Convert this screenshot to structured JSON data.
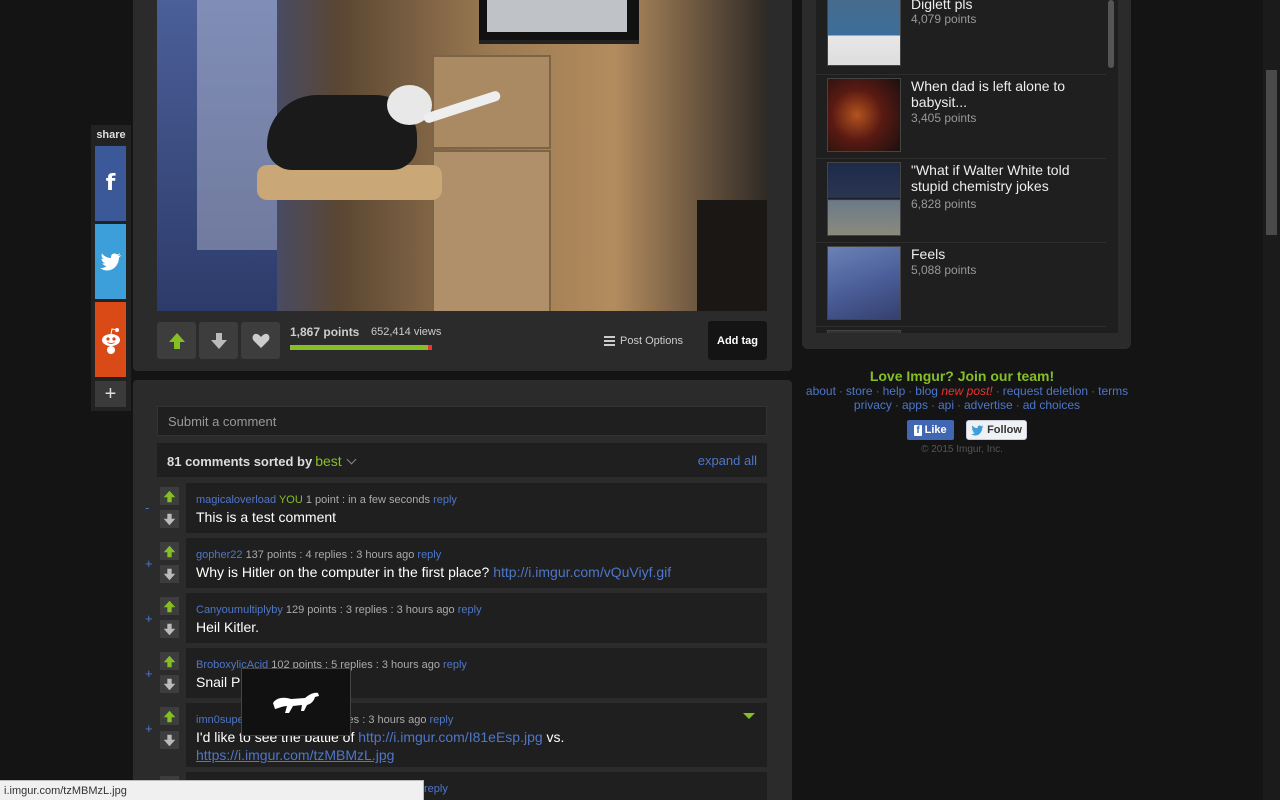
{
  "post": {
    "points": "1,867 points",
    "views": "652,414 views",
    "post_options": "Post Options",
    "add_tag": "Add tag",
    "upvote_ratio": 0.97
  },
  "share": {
    "label": "share",
    "more": "+"
  },
  "comments": {
    "placeholder": "Submit a comment",
    "count_label": "81 comments sorted by",
    "sort_value": "best",
    "expand_all": "expand all",
    "items": [
      {
        "user": "magicaloverload",
        "you": "YOU",
        "meta": "1 point : in a few seconds",
        "reply": "reply",
        "text": "This is a test comment",
        "toggle": "-"
      },
      {
        "user": "gopher22",
        "meta": "137 points : 4 replies : 3 hours ago",
        "reply": "reply",
        "text": "Why is Hitler on the computer in the first place?",
        "link": "http://i.imgur.com/vQuViyf.gif",
        "toggle": "+"
      },
      {
        "user": "Canyoumultiplyby",
        "meta": "129 points : 3 replies : 3 hours ago",
        "reply": "reply",
        "text": "Heil Kitler.",
        "toggle": "+"
      },
      {
        "user": "BroboxylicAcid",
        "meta": "102 points : 5 replies : 3 hours ago",
        "reply": "reply",
        "text": "Snail P",
        "toggle": "+"
      },
      {
        "user": "imn0supe",
        "meta": "replies : 3 hours ago",
        "reply": "reply",
        "text": "I'd like to see the battle of",
        "link": "http://i.imgur.com/I81eEsp.jpg",
        "text_after": "vs.",
        "link2": "https://i.imgur.com/tzMBMzL.jpg",
        "toggle": "+"
      },
      {
        "reply": "reply"
      }
    ]
  },
  "status_bar": {
    "url": "i.imgur.com/tzMBMzL.jpg"
  },
  "sidebar": {
    "items": [
      {
        "title": "Diglett pls",
        "points": "4,079 points"
      },
      {
        "title": "When dad is left alone to babysit...",
        "points": "3,405 points"
      },
      {
        "title": "\"What if Walter White told stupid chemistry jokes",
        "points": "6,828 points"
      },
      {
        "title": "Feels",
        "points": "5,088 points"
      }
    ]
  },
  "footer": {
    "love": "Love Imgur? Join our team!",
    "links1": [
      "about",
      "store",
      "help",
      "blog"
    ],
    "new_post": "new post!",
    "links1b": [
      "request deletion",
      "terms"
    ],
    "links2": [
      "privacy",
      "apps",
      "api",
      "advertise",
      "ad choices"
    ],
    "fb_like": "Like",
    "tw_follow": "Follow",
    "copyright": "© 2015 Imgur, Inc."
  },
  "colors": {
    "accent_green": "#85bf25",
    "link_blue": "#4e76c9",
    "background": "#141414",
    "panel": "#2b2b2b"
  }
}
